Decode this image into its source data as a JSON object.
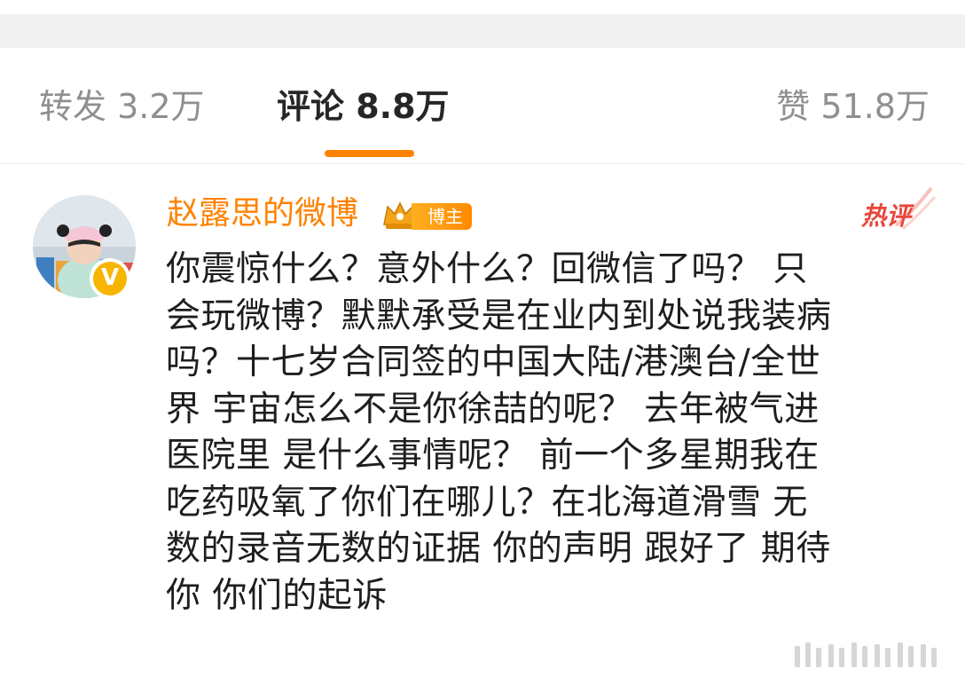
{
  "colors": {
    "accent": "#ff8200",
    "hot": "#e8473c",
    "verified": "#f7b500"
  },
  "tabs": [
    {
      "label": "转发 3.2万"
    },
    {
      "label": "评论 8.8万",
      "active": true
    },
    {
      "label": "赞 51.8万"
    }
  ],
  "comment": {
    "username": "赵露思的微博",
    "badge": "博主",
    "verified_mark": "V",
    "hot_label": "热评",
    "lines": [
      "你震惊什么？意外什么？回微信了吗？ 只",
      "会玩微博？默默承受是在业内到处说我装病",
      "吗？十七岁合同签的中国大陆/港澳台/全世",
      "界  宇宙怎么不是你徐喆的呢？ 去年被气进",
      "医院里 是什么事情呢？ 前一个多星期我在",
      "吃药吸氧了你们在哪儿？在北海道滑雪 无",
      "数的录音无数的证据 你的声明 跟好了 期待",
      "你 你们的起诉"
    ]
  },
  "icons": {
    "avatar": "avatar-photo",
    "verified": "verified-badge-icon",
    "crown": "crown-icon",
    "hot": "hot-comment-icon"
  }
}
